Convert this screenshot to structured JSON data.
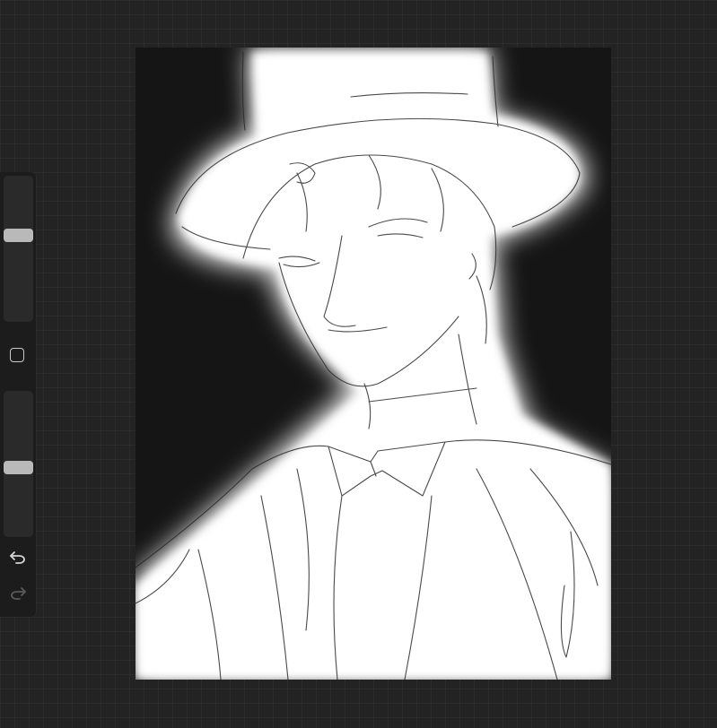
{
  "app": {
    "background_color": "#232323",
    "accent_color": "#b9b9b9"
  },
  "sidebar": {
    "brush_size": {
      "icon": "brush-size-slider",
      "level": 0.6
    },
    "modify_button": {
      "icon": "square-icon"
    },
    "brush_opacity": {
      "icon": "brush-opacity-slider",
      "level": 0.47
    },
    "undo_button": {
      "icon": "undo-icon",
      "enabled": true
    },
    "redo_button": {
      "icon": "redo-icon",
      "enabled": false
    }
  },
  "canvas": {
    "content": "sketch-artwork",
    "background_color": "#151515",
    "stroke_color": "#2a2a2a"
  }
}
